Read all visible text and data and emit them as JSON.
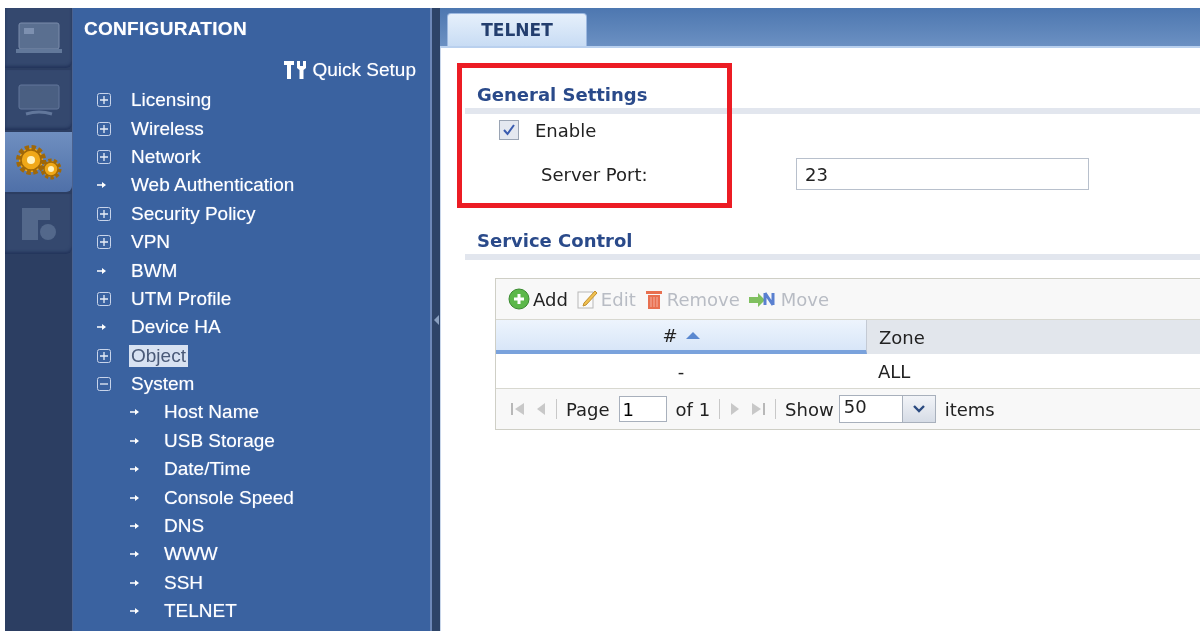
{
  "rail": [
    {
      "kind": "dashboard",
      "selected": false
    },
    {
      "kind": "monitor",
      "selected": false
    },
    {
      "kind": "configuration",
      "selected": true
    },
    {
      "kind": "maintenance",
      "selected": false
    }
  ],
  "sidebar": {
    "title": "CONFIGURATION",
    "quick_setup": "Quick Setup",
    "items": [
      {
        "label": "Licensing",
        "kind": "group",
        "expanded": false,
        "selected": false
      },
      {
        "label": "Wireless",
        "kind": "group",
        "expanded": false,
        "selected": false
      },
      {
        "label": "Network",
        "kind": "group",
        "expanded": false,
        "selected": false
      },
      {
        "label": "Web Authentication",
        "kind": "leaf",
        "selected": false
      },
      {
        "label": "Security Policy",
        "kind": "group",
        "expanded": false,
        "selected": false
      },
      {
        "label": "VPN",
        "kind": "group",
        "expanded": false,
        "selected": false
      },
      {
        "label": "BWM",
        "kind": "leaf",
        "selected": false
      },
      {
        "label": "UTM Profile",
        "kind": "group",
        "expanded": false,
        "selected": false
      },
      {
        "label": "Device HA",
        "kind": "leaf",
        "selected": false
      },
      {
        "label": "Object",
        "kind": "group",
        "expanded": false,
        "selected": true
      },
      {
        "label": "System",
        "kind": "group",
        "expanded": true,
        "selected": false,
        "children": [
          {
            "label": "Host Name",
            "kind": "leaf",
            "selected": false
          },
          {
            "label": "USB Storage",
            "kind": "leaf",
            "selected": false
          },
          {
            "label": "Date/Time",
            "kind": "leaf",
            "selected": false
          },
          {
            "label": "Console Speed",
            "kind": "leaf",
            "selected": false
          },
          {
            "label": "DNS",
            "kind": "leaf",
            "selected": false
          },
          {
            "label": "WWW",
            "kind": "leaf",
            "selected": false
          },
          {
            "label": "SSH",
            "kind": "leaf",
            "selected": false
          },
          {
            "label": "TELNET",
            "kind": "leaf",
            "selected": false
          }
        ]
      }
    ]
  },
  "tabs": [
    {
      "label": "TELNET",
      "selected": true
    }
  ],
  "general_settings": {
    "title": "General Settings",
    "enable": {
      "label": "Enable",
      "checked": true
    },
    "server_port": {
      "label": "Server Port:",
      "value": "23"
    }
  },
  "service_control": {
    "title": "Service Control",
    "toolbar": [
      {
        "kind": "add",
        "label": "Add",
        "disabled": false
      },
      {
        "kind": "edit",
        "label": "Edit",
        "disabled": true
      },
      {
        "kind": "remove",
        "label": "Remove",
        "disabled": true
      },
      {
        "kind": "move",
        "label": "Move",
        "disabled": true
      }
    ],
    "columns": [
      {
        "label": "#",
        "sorted": true
      },
      {
        "label": "Zone",
        "sorted": false
      }
    ],
    "rows": [
      [
        "-",
        "ALL"
      ]
    ],
    "pager": {
      "page_label": "Page",
      "page_value": "1",
      "of_label": "of 1",
      "show_label": "Show",
      "show_value": "50",
      "items_label": "items"
    }
  }
}
